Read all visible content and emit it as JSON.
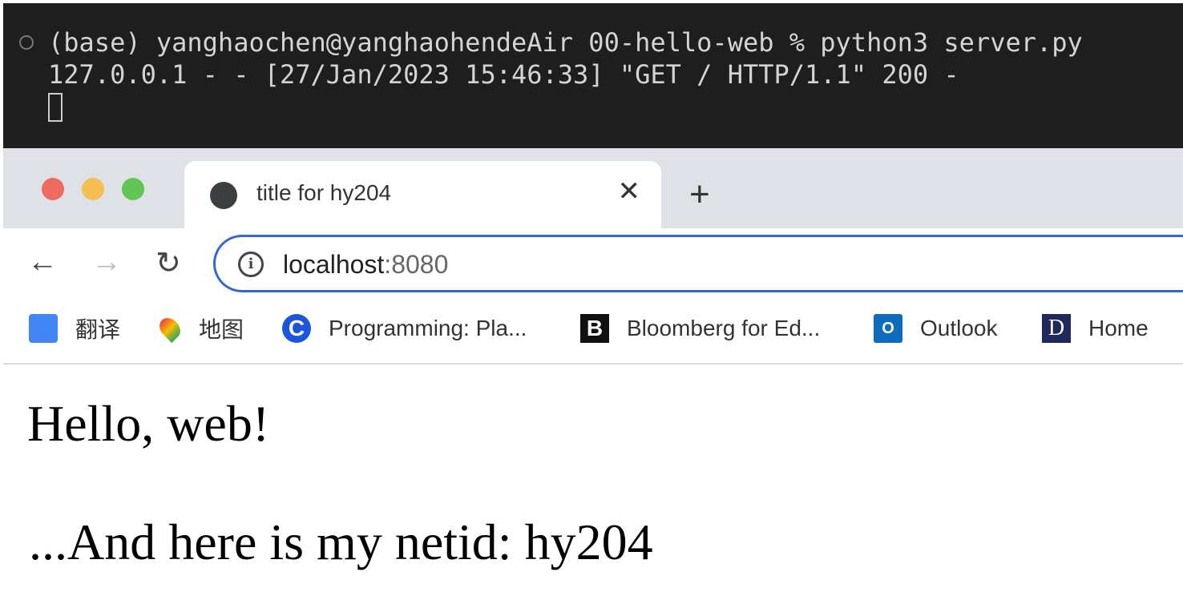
{
  "terminal": {
    "line1": "(base) yanghaochen@yanghaohendeAir 00-hello-web % python3 server.py",
    "line2": "127.0.0.1 - - [27/Jan/2023 15:46:33] \"GET / HTTP/1.1\" 200 -"
  },
  "browser": {
    "tab_title": "title for hy204",
    "close_label": "✕",
    "new_tab_label": "+",
    "back": "←",
    "forward": "→",
    "reload": "↻",
    "info": "i",
    "url_host": "localhost",
    "url_port": ":8080",
    "bookmarks": [
      {
        "label": "翻译",
        "icon": "google-translate-icon"
      },
      {
        "label": "地图",
        "icon": "google-maps-icon"
      },
      {
        "label": "Programming: Pla...",
        "icon": "coursera-c-icon"
      },
      {
        "label": "Bloomberg for Ed...",
        "icon": "bloomberg-b-icon"
      },
      {
        "label": "Outlook",
        "icon": "outlook-icon"
      },
      {
        "label": "Home",
        "icon": "d-icon"
      }
    ]
  },
  "page": {
    "heading": "Hello, web!",
    "text": "...And here is my netid: hy204"
  },
  "colors": {
    "terminal_bg": "#1e1e1e",
    "tabstrip_bg": "#dee1e6",
    "omnibox_border": "#3367d6"
  }
}
